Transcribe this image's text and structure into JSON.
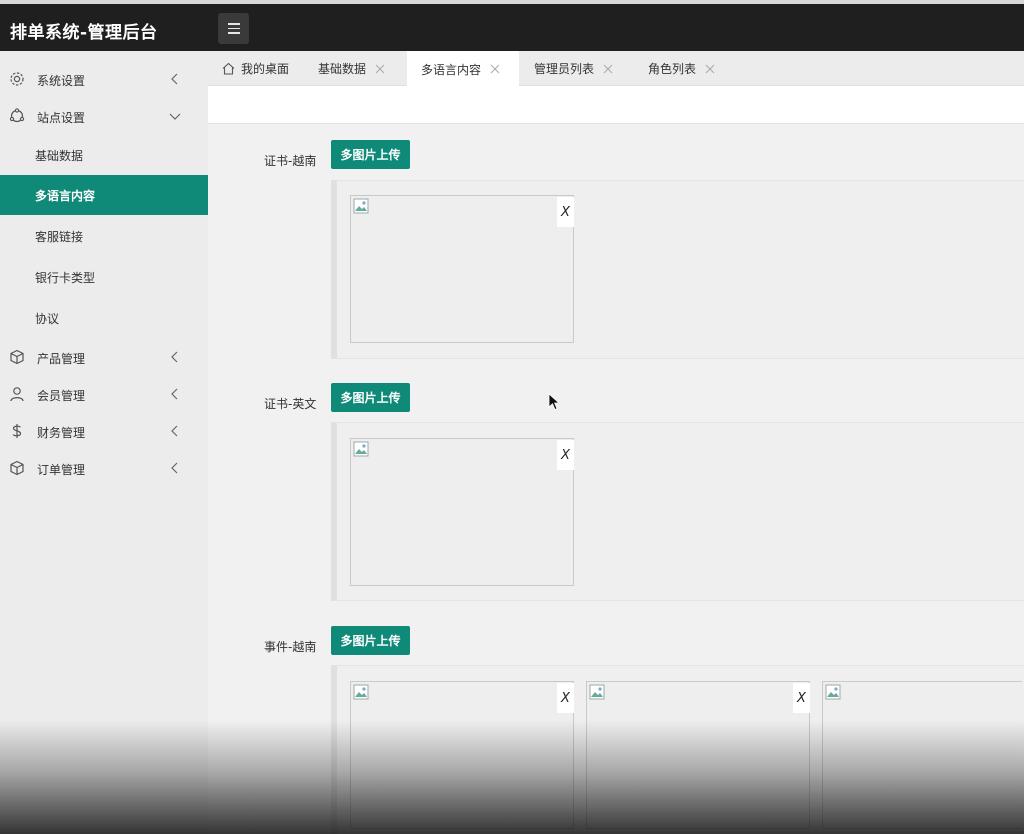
{
  "app": {
    "title": "排单系统-管理后台"
  },
  "sidebar": {
    "items": [
      {
        "label": "系统设置",
        "icon": "gear-icon"
      },
      {
        "label": "站点设置",
        "icon": "shapes-icon"
      },
      {
        "label": "产品管理",
        "icon": "cube-icon"
      },
      {
        "label": "会员管理",
        "icon": "user-icon"
      },
      {
        "label": "财务管理",
        "icon": "dollar-icon"
      },
      {
        "label": "订单管理",
        "icon": "cube-icon"
      }
    ],
    "sub_items": [
      {
        "label": "基础数据"
      },
      {
        "label": "多语言内容",
        "active": true
      },
      {
        "label": "客服链接"
      },
      {
        "label": "银行卡类型"
      },
      {
        "label": "协议"
      }
    ]
  },
  "tabs": [
    {
      "label": "我的桌面"
    },
    {
      "label": "基础数据"
    },
    {
      "label": "多语言内容",
      "active": true
    },
    {
      "label": "管理员列表"
    },
    {
      "label": "角色列表"
    }
  ],
  "sections": [
    {
      "label": "证书-越南",
      "button": "多图片上传",
      "images": [
        {
          "delete_label": "X"
        }
      ]
    },
    {
      "label": "证书-英文",
      "button": "多图片上传",
      "images": [
        {
          "delete_label": "X"
        }
      ]
    },
    {
      "label": "事件-越南",
      "button": "多图片上传",
      "images": [
        {
          "delete_label": "X"
        },
        {
          "delete_label": "X"
        },
        {
          "delete_label": ""
        }
      ]
    }
  ],
  "colors": {
    "accent": "#0f8a78",
    "topbar": "#1f1f1f",
    "sidebar": "#ececec"
  }
}
